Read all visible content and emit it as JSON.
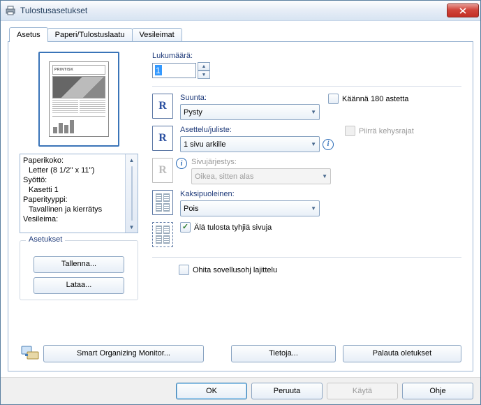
{
  "window": {
    "title": "Tulostusasetukset"
  },
  "tabs": [
    "Asetus",
    "Paperi/Tulostuslaatu",
    "Vesileimat"
  ],
  "summary": {
    "paperSizeLabel": "Paperikoko:",
    "paperSizeValue": "Letter (8 1/2'' x 11'')",
    "inputLabel": "Syöttö:",
    "inputValue": "Kasetti 1",
    "paperTypeLabel": "Paperityyppi:",
    "paperTypeValue": "Tavallinen ja kierrätys",
    "watermarkLabel": "Vesileima:"
  },
  "settingsGroup": {
    "title": "Asetukset",
    "save": "Tallenna...",
    "load": "Lataa..."
  },
  "fields": {
    "copies": {
      "label": "Lukumäärä:",
      "value": "1"
    },
    "orientation": {
      "label": "Suunta:",
      "value": "Pysty"
    },
    "rotate180": {
      "label": "Käännä 180 astetta",
      "checked": false
    },
    "layout": {
      "label": "Asettelu/juliste:",
      "value": "1 sivu arkille"
    },
    "drawFrame": {
      "label": "Piirrä kehysrajat",
      "checked": false,
      "disabled": true
    },
    "pageOrder": {
      "label": "Sivujärjestys:",
      "value": "Oikea, sitten alas",
      "disabled": true
    },
    "duplex": {
      "label": "Kaksipuoleinen:",
      "value": "Pois"
    },
    "skipBlank": {
      "label": "Älä tulosta tyhjiä sivuja",
      "checked": true
    },
    "ignoreAppSort": {
      "label": "Ohita sovellusohj lajittelu",
      "checked": false
    }
  },
  "buttons": {
    "smartMonitor": "Smart Organizing Monitor...",
    "about": "Tietoja...",
    "restoreDefaults": "Palauta oletukset"
  },
  "dialog": {
    "ok": "OK",
    "cancel": "Peruuta",
    "apply": "Käytä",
    "help": "Ohje"
  }
}
